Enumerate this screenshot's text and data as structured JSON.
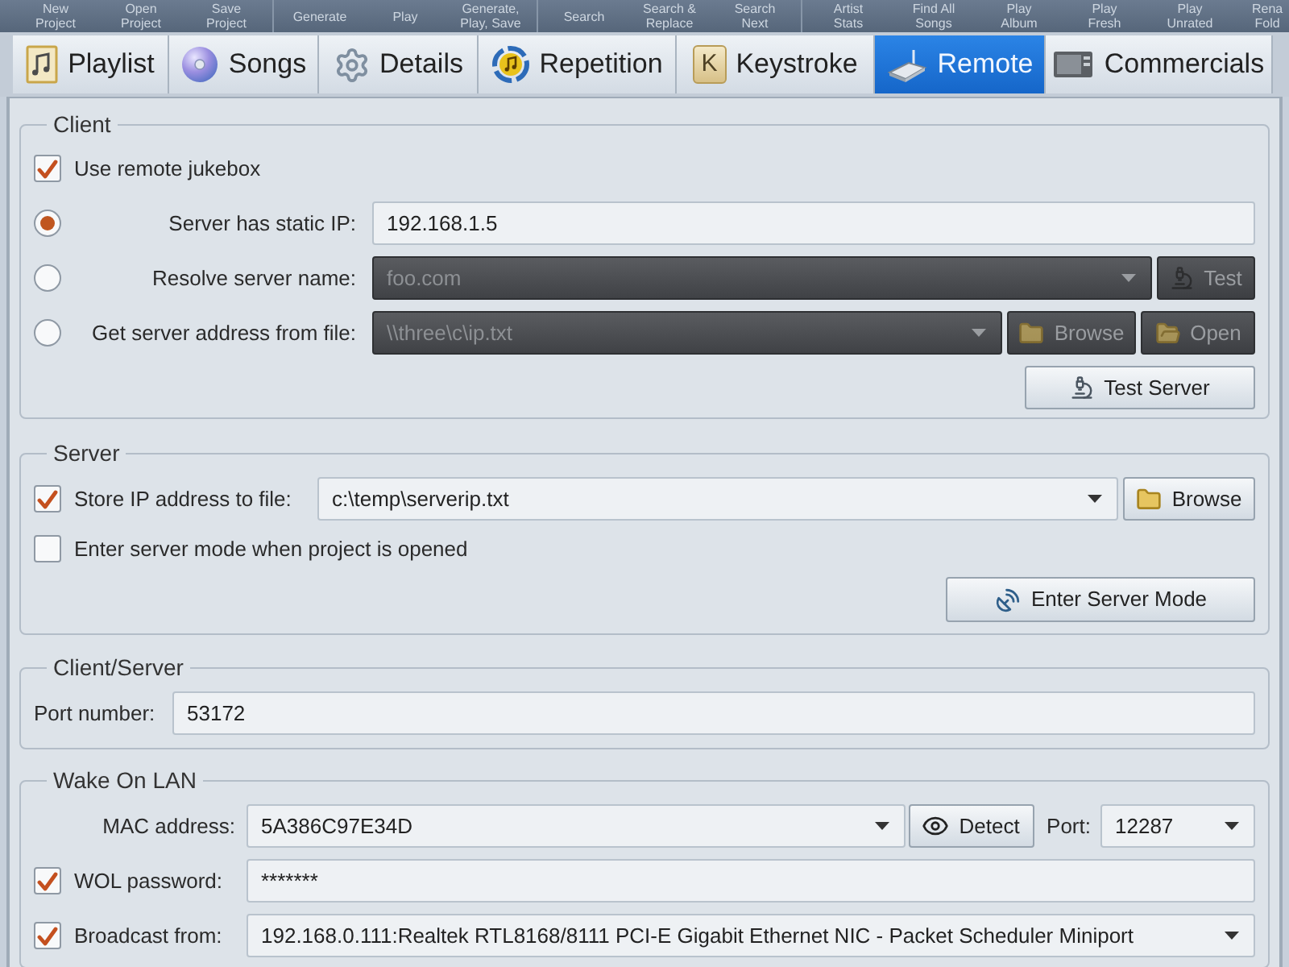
{
  "toolbar": {
    "groups": [
      [
        {
          "lines": [
            "New",
            "Project"
          ]
        },
        {
          "lines": [
            "Open",
            "Project"
          ]
        },
        {
          "lines": [
            "Save",
            "Project"
          ]
        }
      ],
      [
        {
          "lines": [
            "Generate"
          ]
        },
        {
          "lines": [
            "Play"
          ]
        },
        {
          "lines": [
            "Generate,",
            "Play, Save"
          ]
        }
      ],
      [
        {
          "lines": [
            "Search"
          ]
        },
        {
          "lines": [
            "Search &",
            "Replace"
          ]
        },
        {
          "lines": [
            "Search",
            "Next"
          ]
        }
      ],
      [
        {
          "lines": [
            "Artist",
            "Stats"
          ]
        },
        {
          "lines": [
            "Find All",
            "Songs"
          ]
        },
        {
          "lines": [
            "Play",
            "Album"
          ]
        },
        {
          "lines": [
            "Play",
            "Fresh"
          ]
        },
        {
          "lines": [
            "Play",
            "Unrated"
          ]
        },
        {
          "lines": [
            "Rena",
            "Fold"
          ]
        }
      ]
    ]
  },
  "tabs": [
    {
      "label": "Playlist",
      "selected": false
    },
    {
      "label": "Songs",
      "selected": false
    },
    {
      "label": "Details",
      "selected": false
    },
    {
      "label": "Repetition",
      "selected": false
    },
    {
      "label": "Keystroke",
      "selected": false,
      "icon_text": "K"
    },
    {
      "label": "Remote",
      "selected": true
    },
    {
      "label": "Commercials",
      "selected": false
    }
  ],
  "client": {
    "title": "Client",
    "use_remote": {
      "label": "Use remote jukebox",
      "checked": true
    },
    "options": [
      {
        "label": "Server has static IP:",
        "selected": true,
        "field": {
          "kind": "text",
          "value": "192.168.1.5",
          "disabled": false
        }
      },
      {
        "label": "Resolve server name:",
        "selected": false,
        "field": {
          "kind": "combo",
          "value": "foo.com",
          "disabled": true
        },
        "buttons": [
          {
            "kind": "test",
            "label": "Test",
            "disabled": true
          }
        ]
      },
      {
        "label": "Get server address from file:",
        "selected": false,
        "field": {
          "kind": "combo",
          "value": "\\\\three\\c\\ip.txt",
          "disabled": true
        },
        "buttons": [
          {
            "kind": "browse",
            "label": "Browse",
            "disabled": true
          },
          {
            "kind": "open",
            "label": "Open",
            "disabled": true
          }
        ]
      }
    ],
    "test_button": "Test Server"
  },
  "server": {
    "title": "Server",
    "store": {
      "label": "Store IP address to file:",
      "checked": true,
      "value": "c:\\temp\\serverip.txt",
      "button": "Browse"
    },
    "server_mode": {
      "label": "Enter server mode when project is opened",
      "checked": false
    },
    "enter_button": "Enter Server Mode"
  },
  "client_server": {
    "title": "Client/Server",
    "port": {
      "label": "Port number:",
      "value": "53172"
    }
  },
  "wake_on_lan": {
    "title": "Wake On LAN",
    "mac": {
      "label": "MAC address:",
      "value": "5A386C97E34D",
      "button": "Detect"
    },
    "port": {
      "label": "Port:",
      "value": "12287"
    },
    "password": {
      "label": "WOL password:",
      "checked": true,
      "value": "*******"
    },
    "broadcast": {
      "label": "Broadcast from:",
      "checked": true,
      "value": "192.168.0.111:Realtek RTL8168/8111 PCI-E Gigabit Ethernet NIC - Packet Scheduler Miniport"
    }
  }
}
